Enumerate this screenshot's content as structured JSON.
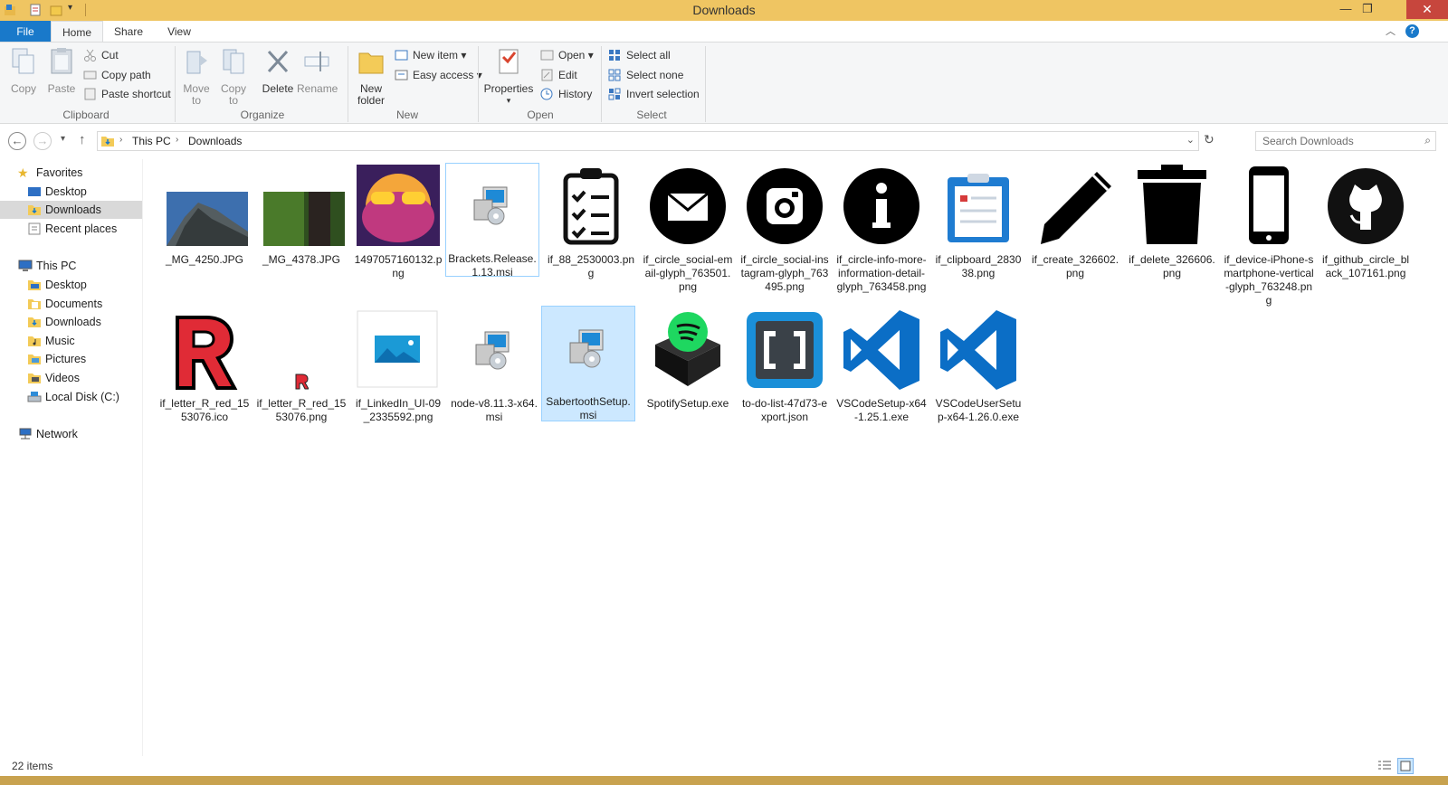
{
  "window": {
    "title": "Downloads",
    "minimize": "—",
    "maximize": "❐",
    "close": "✕"
  },
  "tabs": {
    "file": "File",
    "home": "Home",
    "share": "Share",
    "view": "View"
  },
  "ribbon": {
    "clipboard": {
      "label": "Clipboard",
      "copy": "Copy",
      "paste": "Paste",
      "cut": "Cut",
      "copy_path": "Copy path",
      "paste_shortcut": "Paste shortcut"
    },
    "organize": {
      "label": "Organize",
      "move_to": "Move to",
      "copy_to": "Copy to",
      "delete": "Delete",
      "rename": "Rename"
    },
    "new": {
      "label": "New",
      "new_folder": "New folder",
      "new_item": "New item",
      "easy_access": "Easy access"
    },
    "open": {
      "label": "Open",
      "properties": "Properties",
      "open": "Open",
      "edit": "Edit",
      "history": "History"
    },
    "select": {
      "label": "Select",
      "select_all": "Select all",
      "select_none": "Select none",
      "invert": "Invert selection"
    }
  },
  "address": {
    "crumbs": [
      "This PC",
      "Downloads"
    ],
    "search_placeholder": "Search Downloads"
  },
  "nav": {
    "favorites": "Favorites",
    "fav_items": [
      "Desktop",
      "Downloads",
      "Recent places"
    ],
    "this_pc": "This PC",
    "pc_items": [
      "Desktop",
      "Documents",
      "Downloads",
      "Music",
      "Pictures",
      "Videos",
      "Local Disk (C:)"
    ],
    "network": "Network"
  },
  "files": [
    {
      "name": "_MG_4250.JPG",
      "icon": "photo-mountain-icon"
    },
    {
      "name": "_MG_4378.JPG",
      "icon": "photo-tree-icon"
    },
    {
      "name": "1497057160132.png",
      "icon": "photo-frog-icon"
    },
    {
      "name": "Brackets.Release.1.13.msi",
      "icon": "installer-icon"
    },
    {
      "name": "if_88_2530003.png",
      "icon": "checklist-icon"
    },
    {
      "name": "if_circle_social-email-glyph_763501.png",
      "icon": "email-circle-icon"
    },
    {
      "name": "if_circle_social-instagram-glyph_763495.png",
      "icon": "instagram-circle-icon"
    },
    {
      "name": "if_circle-info-more-information-detail-glyph_763458.png",
      "icon": "info-circle-icon"
    },
    {
      "name": "if_clipboard_283038.png",
      "icon": "clipboard-icon"
    },
    {
      "name": "if_create_326602.png",
      "icon": "pencil-icon"
    },
    {
      "name": "if_delete_326606.png",
      "icon": "trash-icon"
    },
    {
      "name": "if_device-iPhone-smartphone-vertical-glyph_763248.png",
      "icon": "phone-icon"
    },
    {
      "name": "if_github_circle_black_107161.png",
      "icon": "github-icon"
    },
    {
      "name": "if_letter_R_red_1553076.ico",
      "icon": "letter-r-icon"
    },
    {
      "name": "if_letter_R_red_1553076.png",
      "icon": "letter-r-small-icon"
    },
    {
      "name": "if_LinkedIn_UI-09_2335592.png",
      "icon": "image-placeholder-icon"
    },
    {
      "name": "node-v8.11.3-x64.msi",
      "icon": "installer-icon"
    },
    {
      "name": "SabertoothSetup.msi",
      "icon": "installer-icon"
    },
    {
      "name": "SpotifySetup.exe",
      "icon": "spotify-box-icon"
    },
    {
      "name": "to-do-list-47d73-export.json",
      "icon": "brackets-logo-icon"
    },
    {
      "name": "VSCodeSetup-x64-1.25.1.exe",
      "icon": "vscode-icon"
    },
    {
      "name": "VSCodeUserSetup-x64-1.26.0.exe",
      "icon": "vscode-icon"
    }
  ],
  "status": {
    "count": "22 items"
  }
}
